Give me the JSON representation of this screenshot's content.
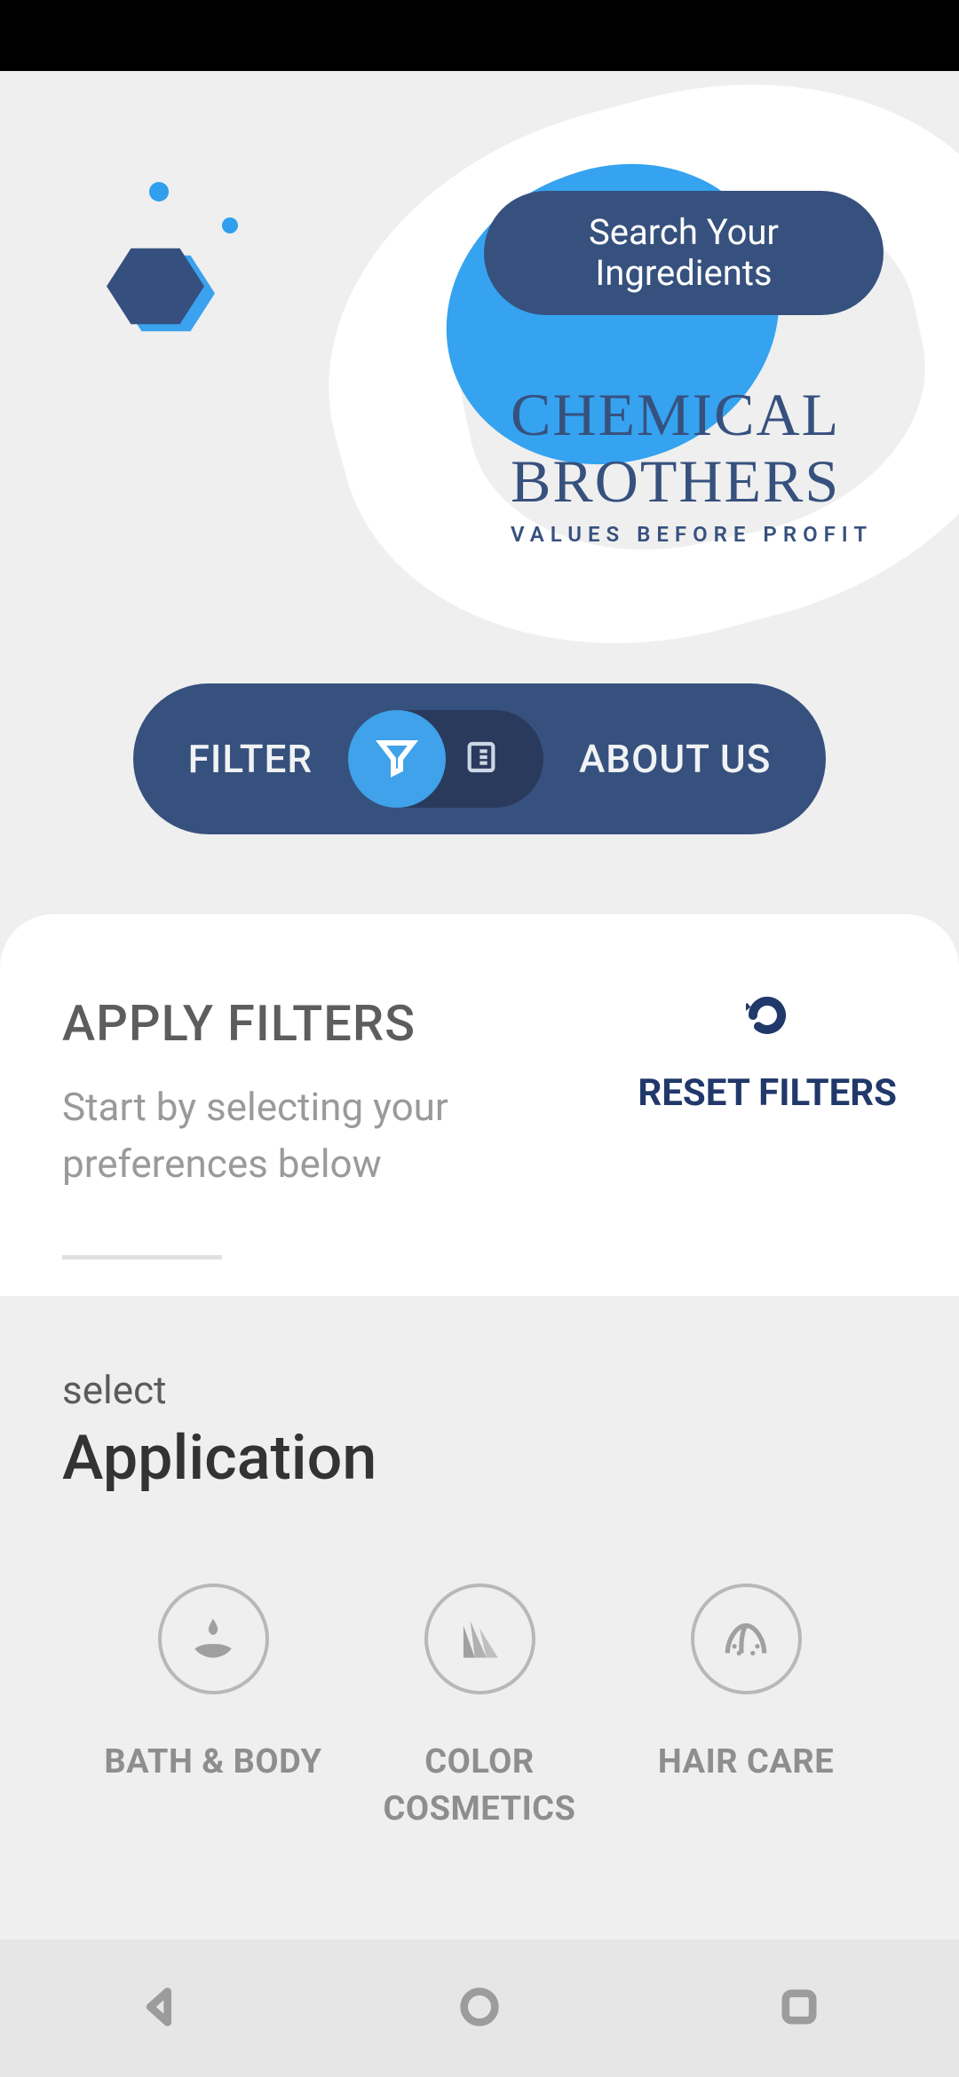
{
  "header": {
    "search_label": "Search Your Ingredients",
    "brand_line1": "CHEMICAL",
    "brand_line2": "BROTHERS",
    "brand_tagline": "VALUES BEFORE PROFIT"
  },
  "toggle": {
    "filter_label": "FILTER",
    "about_label": "ABOUT US",
    "active": "filter"
  },
  "filters_panel": {
    "title": "APPLY FILTERS",
    "description": "Start by selecting your preferences below",
    "reset_label": "RESET FILTERS"
  },
  "application_panel": {
    "select_label": "select",
    "title": "Application",
    "items": [
      {
        "label": "BATH & BODY",
        "icon": "hand-drop-icon"
      },
      {
        "label": "COLOR COSMETICS",
        "icon": "palette-icon"
      },
      {
        "label": "HAIR CARE",
        "icon": "hair-scalp-icon"
      }
    ]
  },
  "colors": {
    "primary_dark": "#37517e",
    "primary_deep": "#21386a",
    "accent_blue": "#35a3f0",
    "background": "#efefef"
  }
}
